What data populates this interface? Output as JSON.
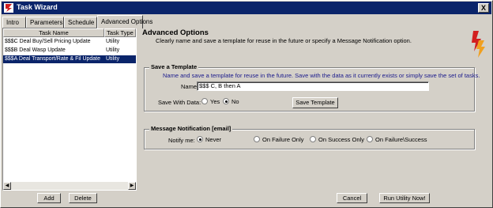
{
  "window": {
    "title": "Task Wizard",
    "close_label": "X"
  },
  "tabs": [
    {
      "label": "Intro"
    },
    {
      "label": "Parameters"
    },
    {
      "label": "Schedule"
    },
    {
      "label": "Advanced Options"
    }
  ],
  "task_list": {
    "columns": [
      "Task Name",
      "Task Type"
    ],
    "rows": [
      {
        "name": "$$$C Deal Buy/Sell Pricing Update",
        "type": "Utility"
      },
      {
        "name": "$$$B Deal Wasp Update",
        "type": "Utility"
      },
      {
        "name": "$$$A Deal Transport/Rate & Fil Update",
        "type": "Utility"
      }
    ],
    "selected_index": 2
  },
  "left_buttons": {
    "add": "Add",
    "delete": "Delete"
  },
  "advanced": {
    "title": "Advanced Options",
    "description": "Clearly name and save a template for reuse in the future or specify a Message Notification option."
  },
  "template": {
    "group_label": "Save a Template",
    "note": "Name and save a template for reuse in the future.  Save with the data as it currently exists or simply save the set of tasks.",
    "name_label": "Name:",
    "name_value": "$$$ C, B then A",
    "save_with_data_label": "Save With Data:",
    "yes_label": "Yes",
    "no_label": "No",
    "save_with_data_selected": "No",
    "save_button": "Save Template"
  },
  "notification": {
    "group_label": "Message Notification [email]",
    "notify_label": "Notify me:",
    "options": [
      "Never",
      "On Failure Only",
      "On Success Only",
      "On Failure\\Success"
    ],
    "selected": "Never"
  },
  "footer": {
    "cancel": "Cancel",
    "run": "Run Utility Now!"
  },
  "colors": {
    "title_bar": "#0a246a",
    "selection": "#0a246a",
    "face": "#d4d0c8",
    "note_blue": "#1a1a8c"
  }
}
